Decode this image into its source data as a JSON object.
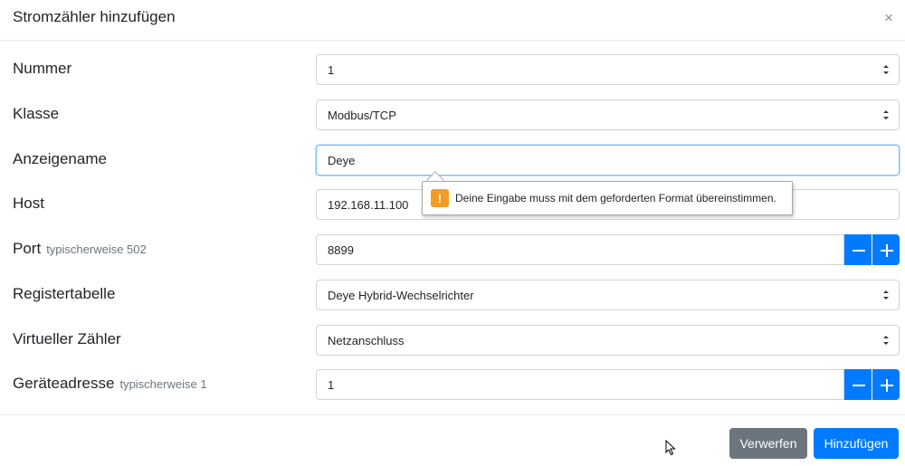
{
  "dialog": {
    "title": "Stromzähler hinzufügen",
    "close_glyph": "×"
  },
  "form": {
    "nummer": {
      "label": "Nummer",
      "value": "1"
    },
    "klasse": {
      "label": "Klasse",
      "value": "Modbus/TCP"
    },
    "anzeigename": {
      "label": "Anzeigename",
      "value": "Deye"
    },
    "host": {
      "label": "Host",
      "value": "192.168.11.100"
    },
    "port": {
      "label": "Port",
      "hint": "typischerweise 502",
      "value": "8899"
    },
    "registertabelle": {
      "label": "Registertabelle",
      "value": "Deye Hybrid-Wechselrichter"
    },
    "virtueller_zaehler": {
      "label": "Virtueller Zähler",
      "value": "Netzanschluss"
    },
    "geraeteadresse": {
      "label": "Geräteadresse",
      "hint": "typischerweise 1",
      "value": "1"
    }
  },
  "validation": {
    "icon_glyph": "!",
    "message": "Deine Eingabe muss mit dem geforderten Format übereinstimmen."
  },
  "footer": {
    "cancel_label": "Verwerfen",
    "submit_label": "Hinzufügen"
  },
  "icons": {
    "close": "close-icon",
    "select_arrow": "select-updown-icon",
    "minus": "minus-icon",
    "plus": "plus-icon",
    "warning": "warning-icon",
    "cursor": "mouse-pointer-icon"
  },
  "colors": {
    "primary": "#007bff",
    "secondary": "#6c757d",
    "warning": "#f59a23",
    "focus_border": "#80bdff"
  }
}
